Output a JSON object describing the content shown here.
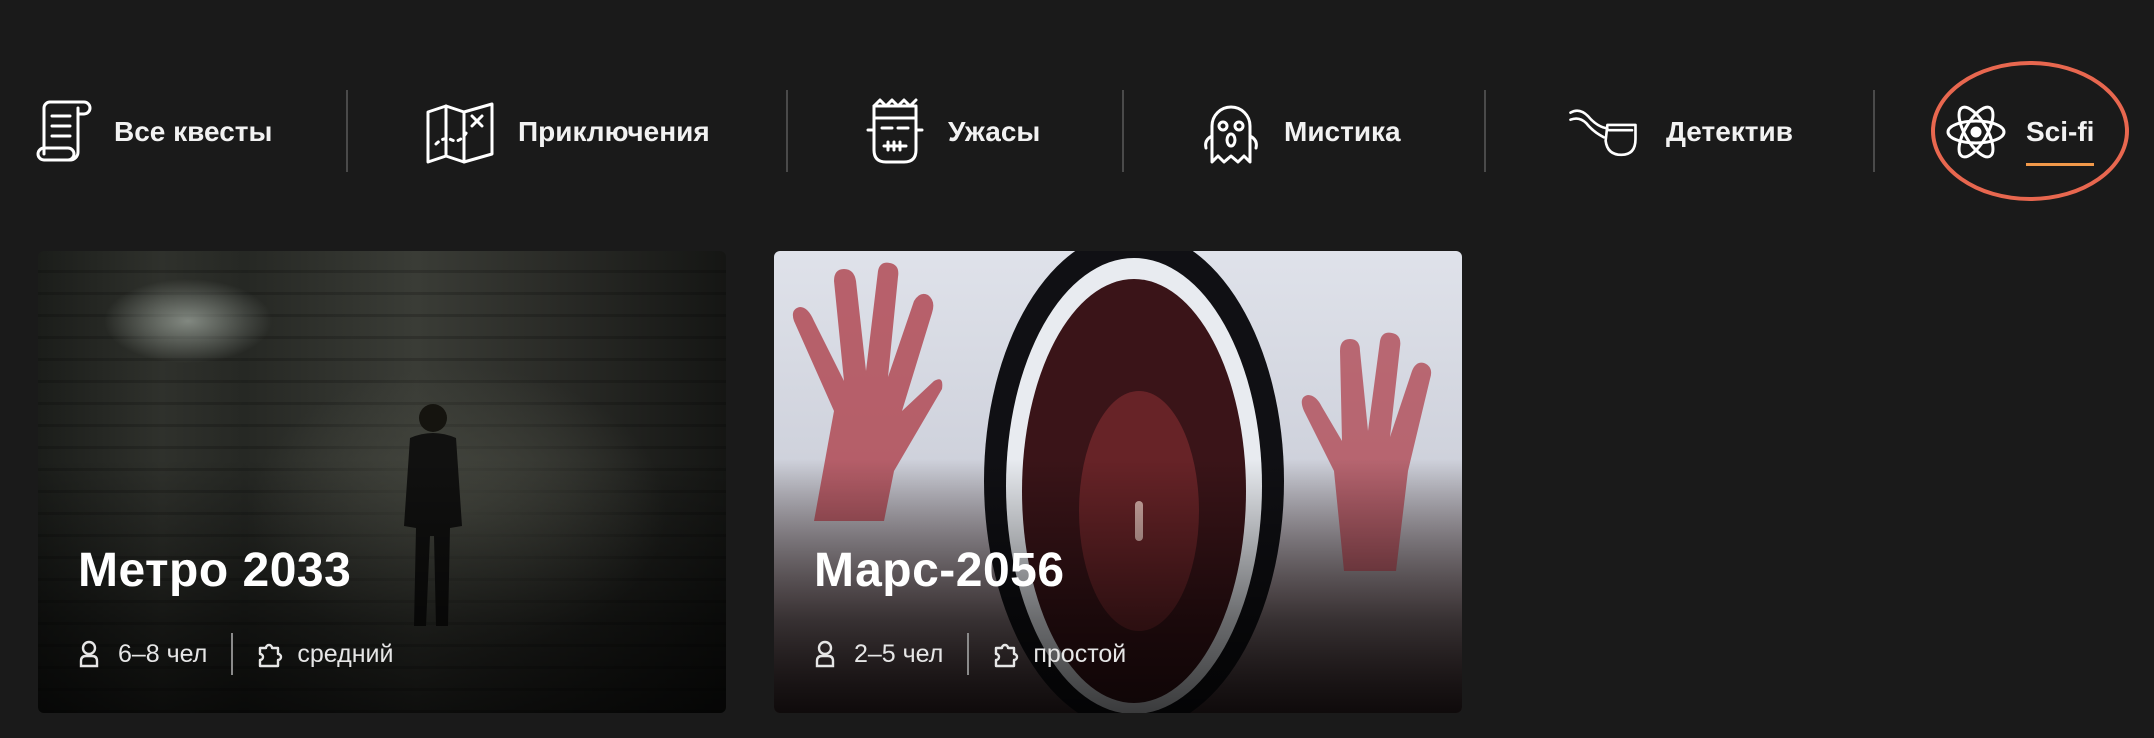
{
  "tabs": [
    {
      "label": "Все квесты",
      "icon": "scroll-icon"
    },
    {
      "label": "Приключения",
      "icon": "map-icon"
    },
    {
      "label": "Ужасы",
      "icon": "frankenstein-icon"
    },
    {
      "label": "Мистика",
      "icon": "ghost-icon"
    },
    {
      "label": "Детектив",
      "icon": "pipe-icon"
    },
    {
      "label": "Sci-fi",
      "icon": "atom-icon",
      "active": true
    }
  ],
  "cards": [
    {
      "title": "Метро 2033",
      "people": "6–8 чел",
      "level": "средний"
    },
    {
      "title": "Марс-2056",
      "people": "2–5 чел",
      "level": "простой"
    }
  ],
  "colors": {
    "background": "#1a1a1a",
    "accent_underline": "#f2994a",
    "highlight_ring": "#e8674f",
    "divider": "#4a4a4a"
  }
}
